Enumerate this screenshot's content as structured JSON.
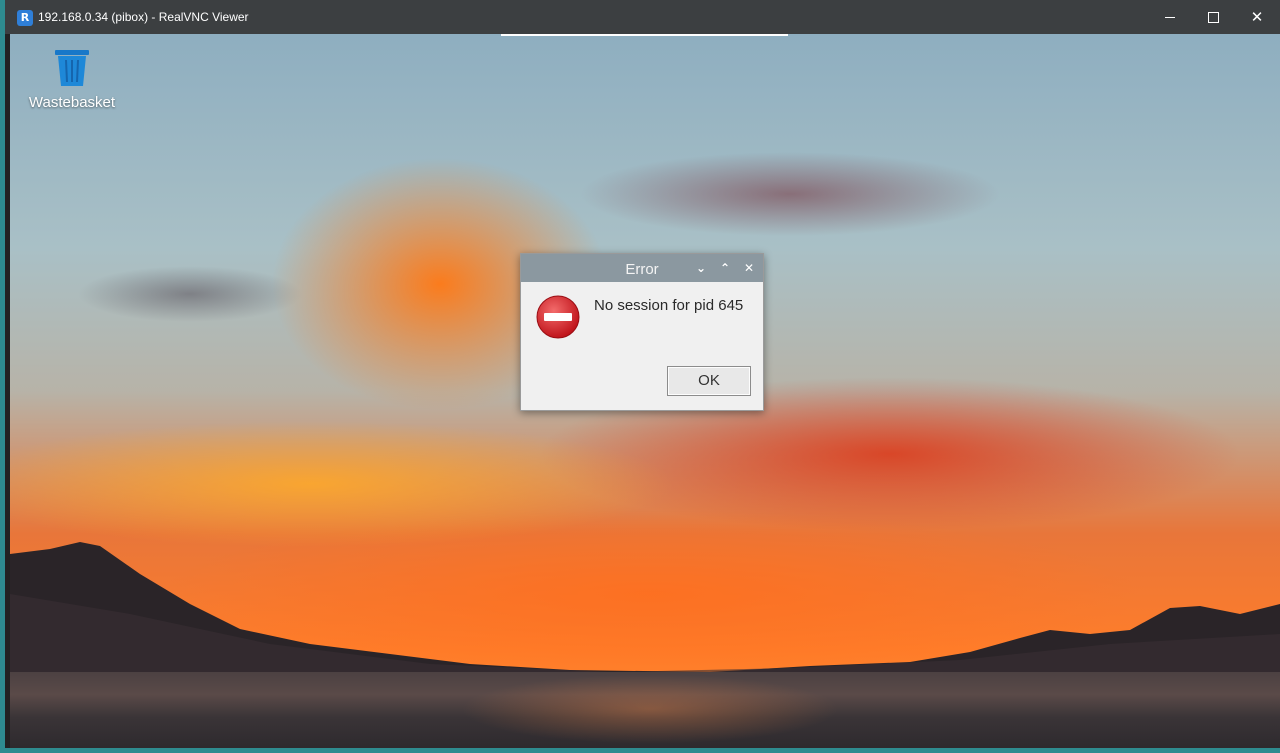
{
  "host_window": {
    "title": "192.168.0.34 (pibox) - RealVNC Viewer",
    "app_icon_glyph": "R",
    "controls": [
      "minimize-icon",
      "maximize-icon",
      "close-icon"
    ],
    "frame_color": "#2e8b8f",
    "titlebar_color": "#3c3f41"
  },
  "desktop": {
    "icons": [
      {
        "label": "Wastebasket",
        "icon": "wastebasket-icon",
        "color": "#1e88d8"
      }
    ]
  },
  "dialog": {
    "title": "Error",
    "controls": [
      "chevron-down-icon",
      "chevron-up-icon",
      "close-icon"
    ],
    "message": "No session for pid 645",
    "icon": "error-stop-icon",
    "icon_color": "#d8232a",
    "ok_label": "OK",
    "titlebar_color": "#8b98a0"
  }
}
